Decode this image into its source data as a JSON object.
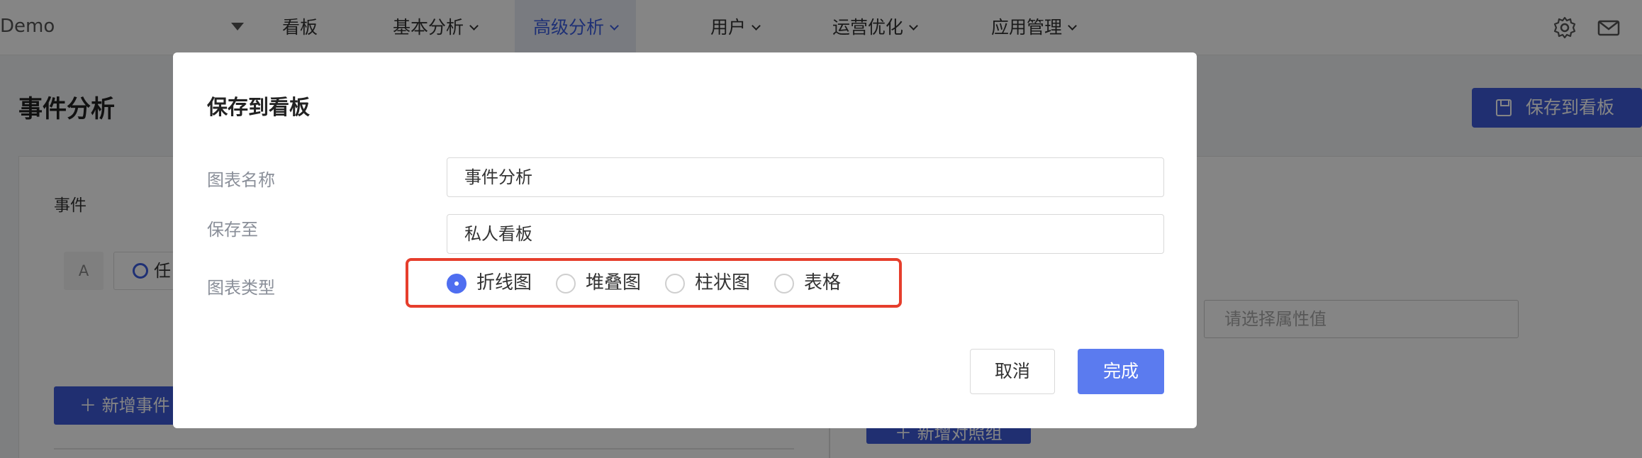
{
  "nav": {
    "brand": "Demo",
    "items": [
      {
        "label": "看板",
        "has_dropdown": false,
        "active": false
      },
      {
        "label": "基本分析",
        "has_dropdown": true,
        "active": false
      },
      {
        "label": "高级分析",
        "has_dropdown": true,
        "active": true
      },
      {
        "label": "用户",
        "has_dropdown": true,
        "active": false
      },
      {
        "label": "运营优化",
        "has_dropdown": true,
        "active": false
      },
      {
        "label": "应用管理",
        "has_dropdown": true,
        "active": false
      }
    ],
    "icons": [
      "gear-icon",
      "mail-icon"
    ]
  },
  "page": {
    "title": "事件分析",
    "save_button": "保存到看板",
    "event_label": "事件",
    "event_letter": "A",
    "event_select_value": "任",
    "add_event_button": "新增事件",
    "attr_placeholder": "请选择属性值",
    "add_compare_button": "新增对照组"
  },
  "modal": {
    "title": "保存到看板",
    "name_label": "图表名称",
    "name_value": "事件分析",
    "save_to_label": "保存至",
    "save_to_value": "私人看板",
    "type_label": "图表类型",
    "chart_types": [
      {
        "label": "折线图",
        "selected": true
      },
      {
        "label": "堆叠图",
        "selected": false
      },
      {
        "label": "柱状图",
        "selected": false
      },
      {
        "label": "表格",
        "selected": false
      }
    ],
    "cancel": "取消",
    "done": "完成"
  },
  "colors": {
    "primary": "#3f5bd8",
    "radio_selected": "#4f6ef0",
    "done_button": "#5b7bef",
    "highlight": "#e63e2c",
    "nav_active_text": "#3a5ce0"
  }
}
